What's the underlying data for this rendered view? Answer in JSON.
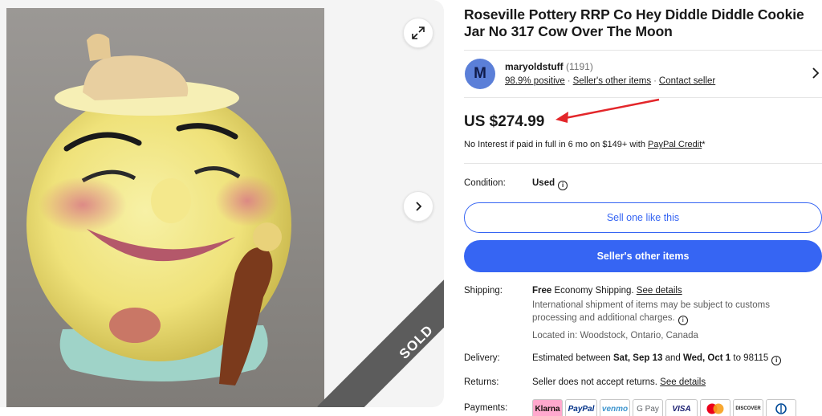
{
  "listing": {
    "title_line1": "Roseville Pottery RRP Co Hey Diddle Diddle Cookie",
    "title_line2": "Jar No 317 Cow Over The Moon",
    "sold_label": "SOLD"
  },
  "seller": {
    "avatar_letter": "M",
    "name": "maryoldstuff",
    "feedback_count": "(1191)",
    "positive": "98.9% positive",
    "other_items_link": "Seller's other items",
    "contact_link": "Contact seller"
  },
  "price": {
    "amount": "US $274.99",
    "finance_prefix": "No Interest if paid in full in 6 mo on $149+ with ",
    "finance_link": "PayPal Credit",
    "finance_suffix": "*"
  },
  "condition": {
    "label": "Condition:",
    "value": "Used"
  },
  "buttons": {
    "sell_one": "Sell one like this",
    "sellers_other": "Seller's other items"
  },
  "shipping": {
    "label": "Shipping:",
    "free": "Free",
    "method": " Economy Shipping. ",
    "details_link": "See details",
    "intl_line1": "International shipment of items may be subject to customs",
    "intl_line2": "processing and additional charges.",
    "location": "Located in: Woodstock, Ontario, Canada"
  },
  "delivery": {
    "label": "Delivery:",
    "prefix": "Estimated between ",
    "start": "Sat, Sep 13",
    "and": " and ",
    "end": "Wed, Oct 1",
    "suffix": " to 98115"
  },
  "returns": {
    "label": "Returns:",
    "text": "Seller does not accept returns. ",
    "details_link": "See details"
  },
  "payments": {
    "label": "Payments:",
    "methods": [
      "Klarna",
      "PayPal",
      "venmo",
      "G Pay",
      "VISA",
      "mastercard",
      "DISCOVER",
      "diners"
    ]
  },
  "colors": {
    "primary_blue": "#3665f3",
    "arrow_red": "#e3262a"
  }
}
